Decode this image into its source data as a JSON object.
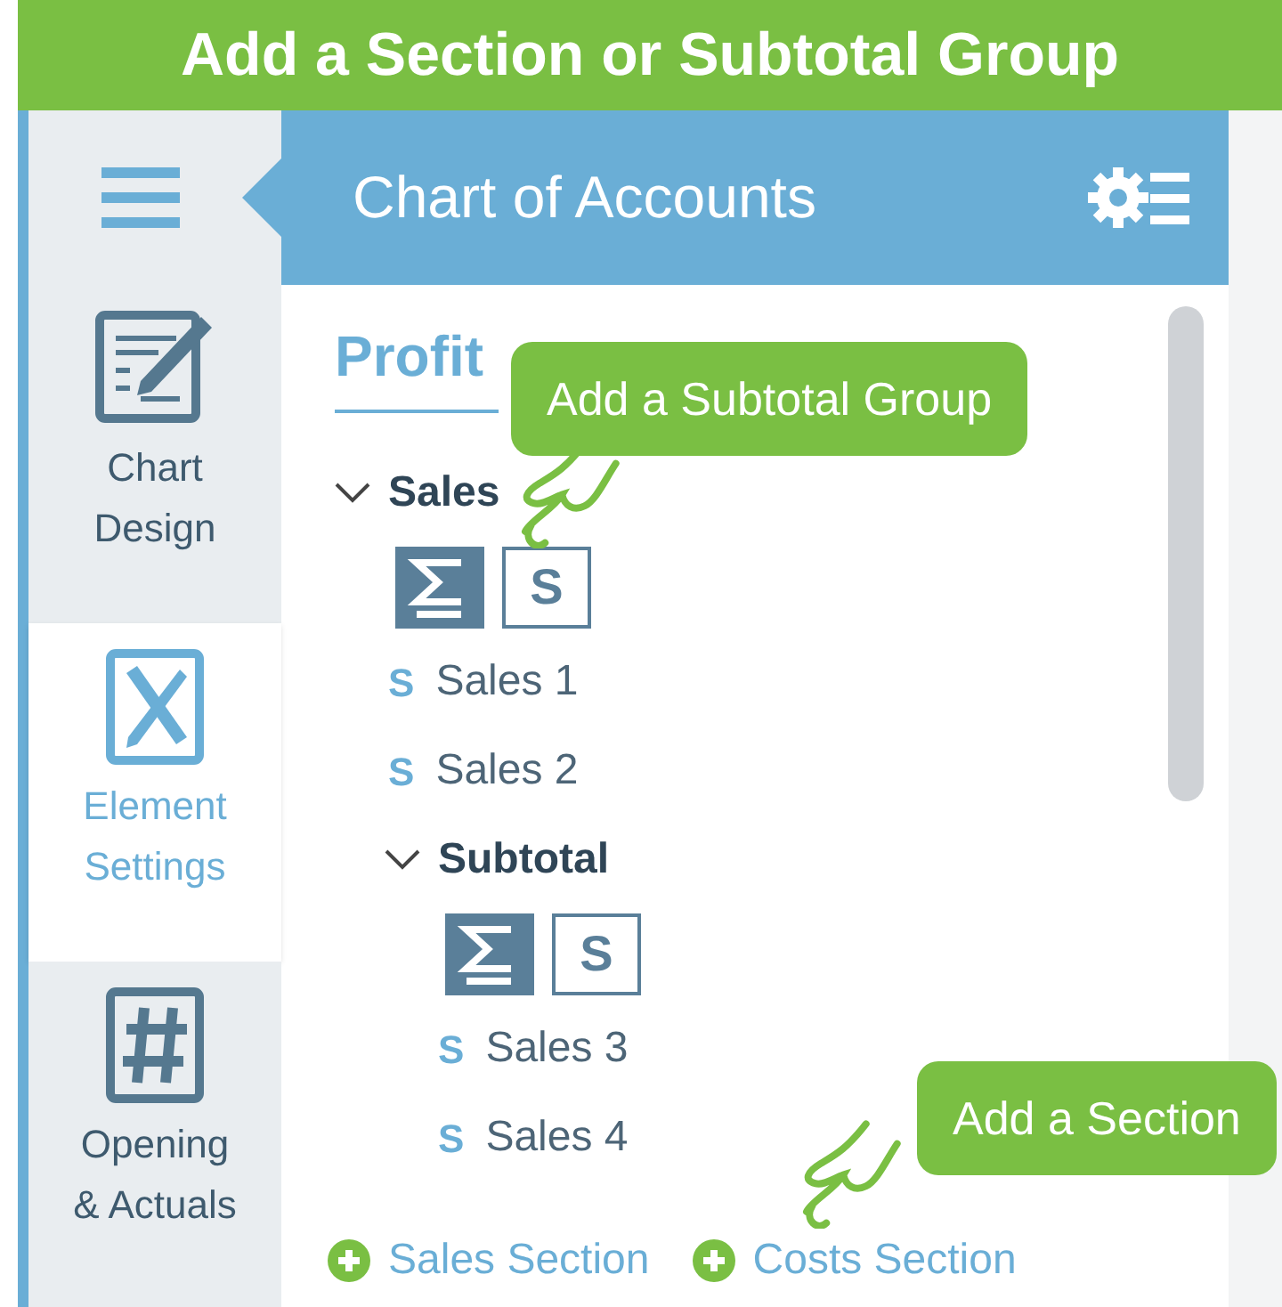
{
  "banner": {
    "title": "Add a Section or Subtotal Group"
  },
  "sidebar": {
    "items": [
      {
        "kind": "design",
        "label": "Chart Design",
        "selected": false
      },
      {
        "kind": "settings",
        "label": "Element Settings",
        "selected": true
      },
      {
        "kind": "hash",
        "label": "Opening & Actuals",
        "selected": false
      }
    ]
  },
  "panel": {
    "title": "Chart of Accounts",
    "heading": "Profit"
  },
  "tree": [
    {
      "kind": "group",
      "label": "Sales",
      "expanded": true,
      "children": [
        {
          "kind": "actions",
          "buttons": [
            {
              "kind": "sigma"
            },
            {
              "kind": "letter",
              "label": "S"
            }
          ]
        },
        {
          "kind": "account",
          "marker": "S",
          "label": "Sales 1"
        },
        {
          "kind": "account",
          "marker": "S",
          "label": "Sales 2"
        },
        {
          "kind": "group",
          "label": "Subtotal",
          "expanded": true,
          "children": [
            {
              "kind": "actions",
              "buttons": [
                {
                  "kind": "sigma"
                },
                {
                  "kind": "letter",
                  "label": "S"
                }
              ]
            },
            {
              "kind": "account",
              "marker": "S",
              "label": "Sales 3"
            },
            {
              "kind": "account",
              "marker": "S",
              "label": "Sales 4"
            }
          ]
        }
      ]
    }
  ],
  "add_links": [
    {
      "label": "Sales Section"
    },
    {
      "label": "Costs Section"
    }
  ],
  "callouts": [
    {
      "kind": "subtotal",
      "text": "Add a Subtotal Group"
    },
    {
      "kind": "section",
      "text": "Add a Section"
    }
  ]
}
